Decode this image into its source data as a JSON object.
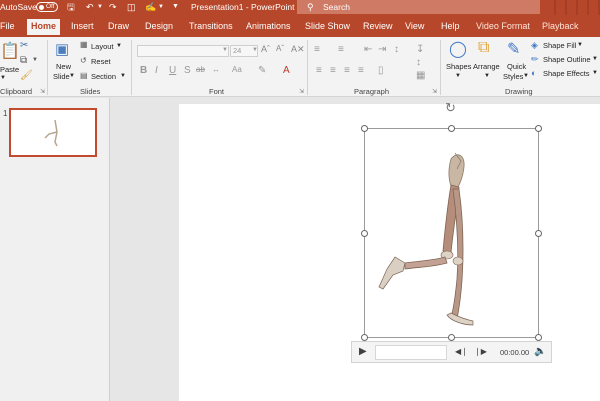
{
  "titlebar": {
    "autosave_label": "AutoSave",
    "autosave_state": "Off",
    "document_title": "Presentation1 - PowerPoint",
    "search_placeholder": "Search"
  },
  "tabs": [
    "File",
    "Home",
    "Insert",
    "Draw",
    "Design",
    "Transitions",
    "Animations",
    "Slide Show",
    "Review",
    "View",
    "Help",
    "Video Format",
    "Playback"
  ],
  "active_tab": "Home",
  "ribbon": {
    "clipboard": {
      "paste_label": "Paste",
      "group_label": "Clipboard"
    },
    "slides": {
      "new_slide_line1": "New",
      "new_slide_line2": "Slide",
      "layout_label": "Layout",
      "reset_label": "Reset",
      "section_label": "Section",
      "group_label": "Slides"
    },
    "font": {
      "font_size": "24",
      "group_label": "Font"
    },
    "paragraph": {
      "group_label": "Paragraph"
    },
    "drawing": {
      "shapes_label": "Shapes",
      "arrange_label": "Arrange",
      "quick_styles_line1": "Quick",
      "quick_styles_line2": "Styles",
      "shape_fill_label": "Shape Fill",
      "shape_outline_label": "Shape Outline",
      "shape_effects_label": "Shape Effects",
      "group_label": "Drawing"
    }
  },
  "thumbnails": [
    {
      "number": "1"
    }
  ],
  "media": {
    "time": "00:00.00"
  },
  "colors": {
    "accent": "#b7472a",
    "selected_thumb_border": "#c24b2f"
  }
}
